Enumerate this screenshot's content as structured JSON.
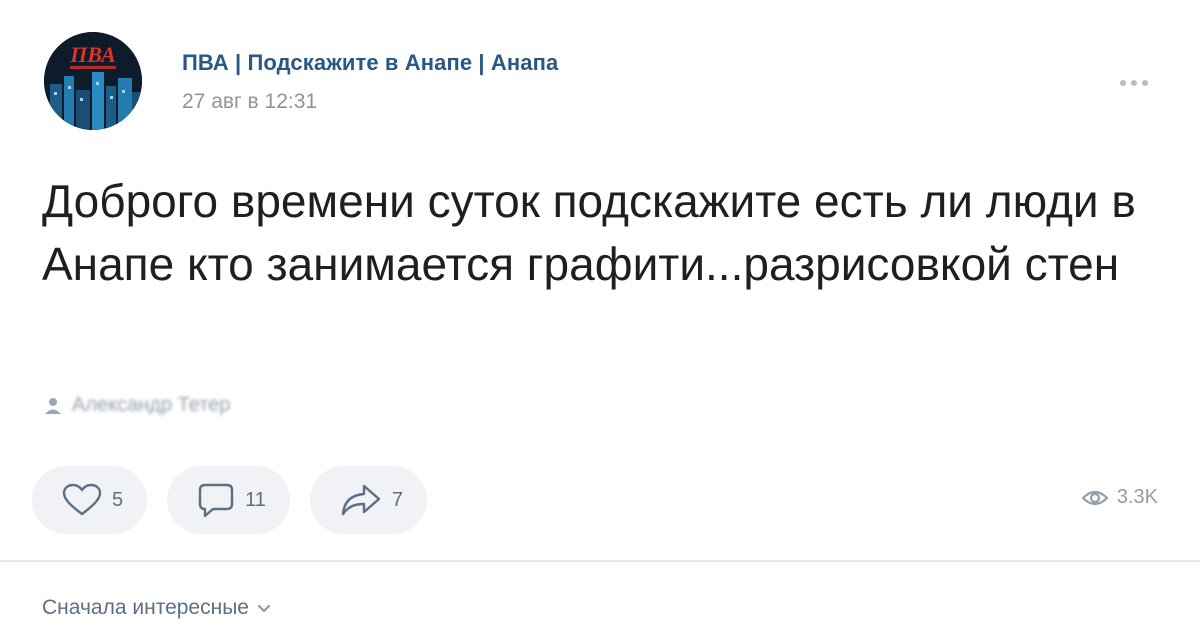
{
  "post": {
    "group_name": "ПВА | Подскажите в Анапе | Анапа",
    "date": "27 авг в 12:31",
    "avatar_text": "ПВА",
    "text": "Доброго времени суток подскажите есть ли люди в Анапе кто занимается графити...разрисовкой стен",
    "author": "Александр Тетер"
  },
  "actions": {
    "likes": "5",
    "comments": "11",
    "shares": "7",
    "views": "3.3K"
  },
  "comments": {
    "sort_label": "Сначала интересные"
  },
  "colors": {
    "link": "#2a5885",
    "muted": "#939393",
    "action_bg": "#f0f2f5",
    "action_icon": "#5c6f84"
  }
}
